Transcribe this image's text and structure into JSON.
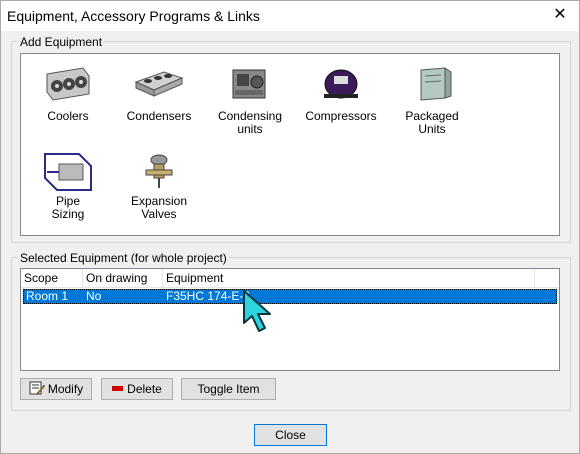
{
  "window": {
    "title": "Equipment, Accessory Programs & Links",
    "close_glyph": "✕"
  },
  "add_equipment": {
    "label": "Add Equipment",
    "items": [
      {
        "line1": "Coolers",
        "line2": "",
        "icon": "cooler-icon"
      },
      {
        "line1": "Condensers",
        "line2": "",
        "icon": "condenser-icon"
      },
      {
        "line1": "Condensing",
        "line2": "units",
        "icon": "condensing-unit-icon"
      },
      {
        "line1": "Compressors",
        "line2": "",
        "icon": "compressor-icon"
      },
      {
        "line1": "Packaged",
        "line2": "Units",
        "icon": "packaged-unit-icon"
      },
      {
        "line1": "Pipe",
        "line2": "Sizing",
        "icon": "pipe-sizing-icon"
      },
      {
        "line1": "Expansion",
        "line2": "Valves",
        "icon": "expansion-valve-icon"
      }
    ]
  },
  "selected_equipment": {
    "label": "Selected Equipment (for whole project)",
    "columns": [
      "Scope",
      "On drawing",
      "Equipment"
    ],
    "rows": [
      {
        "scope": "Room 1",
        "on_drawing": "No",
        "equipment": "F35HC 174-E-6"
      }
    ]
  },
  "buttons": {
    "modify": "Modify",
    "delete": "Delete",
    "toggle": "Toggle Item",
    "close": "Close"
  },
  "colors": {
    "selection": "#0078d7",
    "cursor": "#2bd5e0"
  }
}
